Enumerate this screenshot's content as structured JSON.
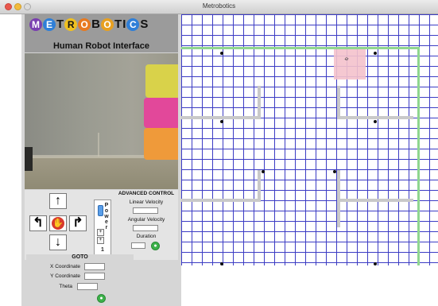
{
  "window": {
    "title": "Metrobotics"
  },
  "header": {
    "logo_letters": [
      "M",
      "E",
      "T",
      "R",
      "O",
      "B",
      "O",
      "T",
      "I",
      "C",
      "S"
    ],
    "subtitle": "Human Robot Interface"
  },
  "drive": {
    "up_icon": "arrow-up-icon",
    "down_icon": "arrow-down-icon",
    "left_icon": "turn-left-icon",
    "right_icon": "turn-right-icon",
    "stop_icon": "stop-hand-icon",
    "glyphs": {
      "up": "↑",
      "down": "↓",
      "left": "↰",
      "right": "↱",
      "stop": "✋"
    }
  },
  "power": {
    "label": "Power",
    "value": "1",
    "plus": "+",
    "minus": "+",
    "slider_level": 0.85
  },
  "advanced": {
    "title": "ADVANCED CONTROL",
    "linear_label": "Linear Velocity",
    "linear_value": "",
    "angular_label": "Angular Velocity",
    "angular_value": "",
    "duration_label": "Duration",
    "duration_value": ""
  },
  "goto": {
    "title": "GOTO",
    "x_label": "X Coordinate",
    "x_value": "",
    "y_label": "Y Coordinate",
    "y_value": "",
    "theta_label": "Theta",
    "theta_value": ""
  },
  "colors": {
    "grid": "#3c3cc4",
    "walls": "#c9c9c9",
    "path": "#8fd68f",
    "robot_zone": "#f4c2cc",
    "go_button": "#3db24a",
    "stop_button": "#d83a2d"
  }
}
